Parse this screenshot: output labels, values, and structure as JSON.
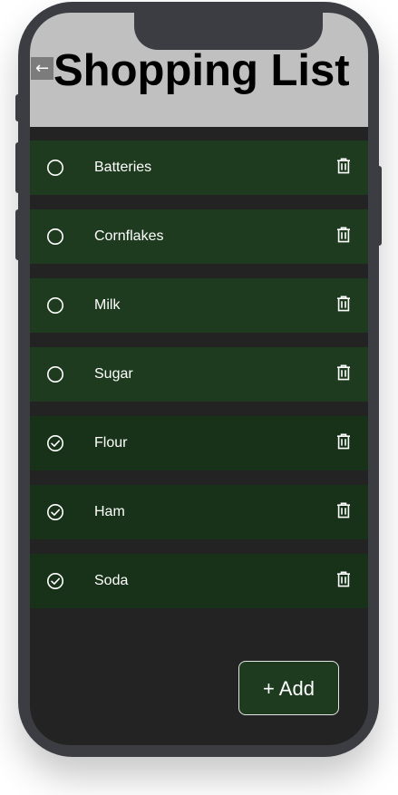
{
  "header": {
    "title": "Shopping List",
    "back_glyph": "←",
    "back_icon": "arrow-left-icon"
  },
  "items": [
    {
      "label": "Batteries",
      "checked": false
    },
    {
      "label": "Cornflakes",
      "checked": false
    },
    {
      "label": "Milk",
      "checked": false
    },
    {
      "label": "Sugar",
      "checked": false
    },
    {
      "label": "Flour",
      "checked": true
    },
    {
      "label": "Ham",
      "checked": true
    },
    {
      "label": "Soda",
      "checked": true
    }
  ],
  "icons": {
    "unchecked": "circle-icon",
    "checked": "check-circle-icon",
    "delete": "trash-icon"
  },
  "add_button": {
    "label": "+ Add"
  },
  "colors": {
    "header_bg": "#c0c0c0",
    "screen_bg": "#222322",
    "item_bg": "#1e3b1f",
    "item_done_bg": "#173218",
    "phone_frame": "#3b3d42",
    "text": "#ffffff"
  }
}
